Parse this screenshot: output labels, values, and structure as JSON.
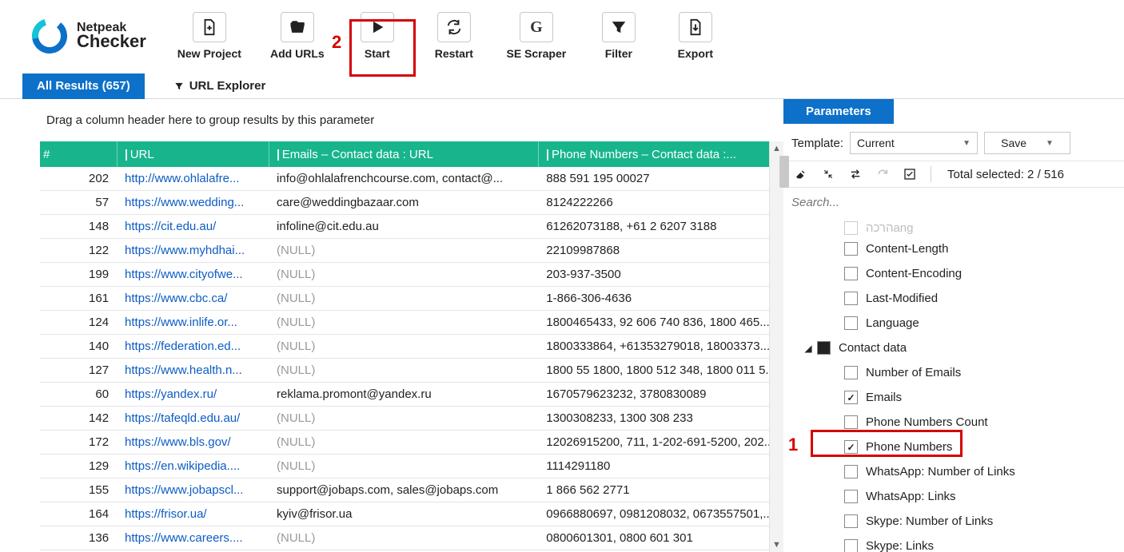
{
  "logo": {
    "brand1": "Netpeak",
    "brand2": "Checker"
  },
  "toolbar": {
    "newProject": "New Project",
    "addUrls": "Add URLs",
    "start": "Start",
    "restart": "Restart",
    "seScraper": "SE Scraper",
    "filter": "Filter",
    "export": "Export",
    "highlightNumber": "2"
  },
  "tabs": {
    "allResults": "All Results (657)",
    "urlExplorer": "URL Explorer"
  },
  "groupHint": "Drag a column header here to group results by this parameter",
  "columns": {
    "num": "#",
    "url": "URL",
    "emails": "Emails  –  Contact data  :  URL",
    "phones": "Phone Numbers  –  Contact data  :..."
  },
  "rows": [
    {
      "n": "202",
      "url": "http://www.ohlalafre...",
      "email": "info@ohlalafrenchcourse.com, contact@...",
      "phone": "888 591 195 00027"
    },
    {
      "n": "57",
      "url": "https://www.wedding...",
      "email": "care@weddingbazaar.com",
      "phone": "8124222266"
    },
    {
      "n": "148",
      "url": "https://cit.edu.au/",
      "email": "infoline@cit.edu.au",
      "phone": "61262073188, +61 2 6207 3188"
    },
    {
      "n": "122",
      "url": "https://www.myhdhai...",
      "email": "(NULL)",
      "phone": "22109987868"
    },
    {
      "n": "199",
      "url": "https://www.cityofwe...",
      "email": "(NULL)",
      "phone": "203-937-3500"
    },
    {
      "n": "161",
      "url": "https://www.cbc.ca/",
      "email": "(NULL)",
      "phone": "1-866-306-4636"
    },
    {
      "n": "124",
      "url": "https://www.inlife.or...",
      "email": "(NULL)",
      "phone": "1800465433, 92 606 740 836, 1800 465..."
    },
    {
      "n": "140",
      "url": "https://federation.ed...",
      "email": "(NULL)",
      "phone": "1800333864, +61353279018, 18003373..."
    },
    {
      "n": "127",
      "url": "https://www.health.n...",
      "email": "(NULL)",
      "phone": "1800 55 1800, 1800 512 348, 1800 011 5..."
    },
    {
      "n": "60",
      "url": "https://yandex.ru/",
      "email": "reklama.promont@yandex.ru",
      "phone": "1670579623232, 3780830089"
    },
    {
      "n": "142",
      "url": "https://tafeqld.edu.au/",
      "email": "(NULL)",
      "phone": "1300308233, 1300 308 233"
    },
    {
      "n": "172",
      "url": "https://www.bls.gov/",
      "email": "(NULL)",
      "phone": "12026915200, 711, 1-202-691-5200, 202..."
    },
    {
      "n": "129",
      "url": "https://en.wikipedia....",
      "email": "(NULL)",
      "phone": "1114291180"
    },
    {
      "n": "155",
      "url": "https://www.jobapscl...",
      "email": "support@jobaps.com, sales@jobaps.com",
      "phone": "1 866 562 2771"
    },
    {
      "n": "164",
      "url": "https://frisor.ua/",
      "email": "kyiv@frisor.ua",
      "phone": "0966880697, 0981208032, 0673557501,..."
    },
    {
      "n": "136",
      "url": "https://www.careers....",
      "email": "(NULL)",
      "phone": "0800601301, 0800 601 301"
    }
  ],
  "params": {
    "tab": "Parameters",
    "templateLabel": "Template:",
    "templateValue": "Current",
    "save": "Save",
    "totalSelected": "Total selected: 2 / 516",
    "searchPlaceholder": "Search...",
    "highlightNumber": "1",
    "partialTop": "הרכהang",
    "items": [
      {
        "label": "Content-Length",
        "checked": false,
        "level": 2
      },
      {
        "label": "Content-Encoding",
        "checked": false,
        "level": 2
      },
      {
        "label": "Last-Modified",
        "checked": false,
        "level": 2
      },
      {
        "label": "Language",
        "checked": false,
        "level": 2
      }
    ],
    "groupLabel": "Contact data",
    "groupItems": [
      {
        "label": "Number of Emails",
        "checked": false
      },
      {
        "label": "Emails",
        "checked": true
      },
      {
        "label": "Phone Numbers Count",
        "checked": false
      },
      {
        "label": "Phone Numbers",
        "checked": true
      },
      {
        "label": "WhatsApp: Number of Links",
        "checked": false
      },
      {
        "label": "WhatsApp: Links",
        "checked": false
      },
      {
        "label": "Skype: Number of Links",
        "checked": false
      },
      {
        "label": "Skype: Links",
        "checked": false
      }
    ]
  }
}
